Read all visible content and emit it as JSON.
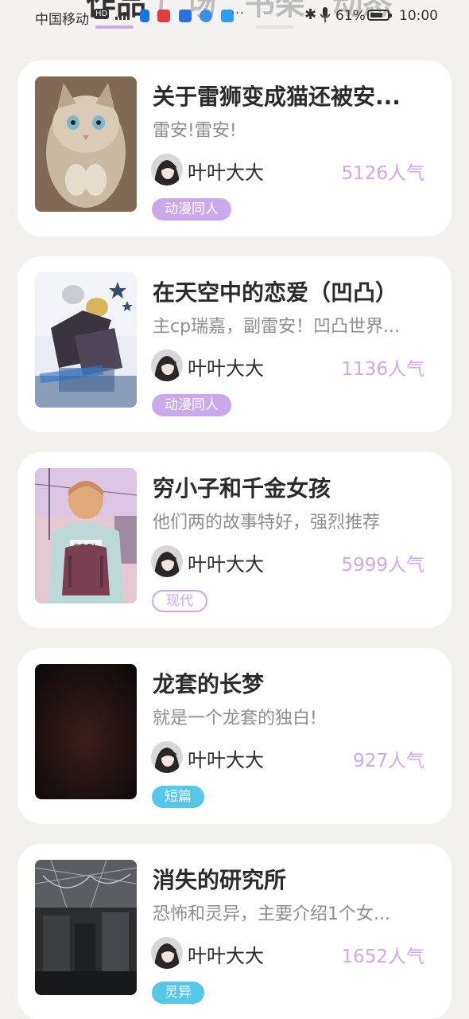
{
  "status_bar": {
    "carrier": "中国移动",
    "hd": "HD",
    "more": "···",
    "battery_pct": "61%",
    "time": "10:00",
    "icons": [
      "signal-icon",
      "wifi-icon",
      "bluetooth-icon",
      "mic-icon",
      "battery-icon"
    ]
  },
  "tabs": [
    {
      "label": "作品",
      "active": true
    },
    {
      "label": "广场",
      "active": false
    },
    {
      "label": "书架",
      "active": false
    },
    {
      "label": "动态",
      "active": false
    }
  ],
  "colors": {
    "accent": "#c9a8ec",
    "popularity": "#cfa9ea",
    "tag_purple": "#c9a8ec",
    "tag_cyan": "#55c8ea",
    "background": "#f3f1ed"
  },
  "works": [
    {
      "title": "关于雷狮变成猫还被安...",
      "desc": "雷安!雷安!",
      "author": "叶叶大大",
      "popularity": "5126人气",
      "tag": "动漫同人",
      "tag_style": "filled",
      "tag_color": "#c9a8ec",
      "cover": "kitten-cover-image"
    },
    {
      "title": "在天空中的恋爱（凹凸）",
      "desc": "主cp瑞嘉，副雷安！凹凸世界...",
      "author": "叶叶大大",
      "popularity": "1136人气",
      "tag": "动漫同人",
      "tag_style": "filled",
      "tag_color": "#c9a8ec",
      "cover": "anime-couple-cover-image"
    },
    {
      "title": "穷小子和千金女孩",
      "desc": "他们两的故事特好，强烈推荐",
      "author": "叶叶大大",
      "popularity": "5999人气",
      "tag": "现代",
      "tag_style": "outline",
      "tag_color": "#c9a8ec",
      "cover": "boy-backpack-cover-image"
    },
    {
      "title": "龙套的长梦",
      "desc": "就是一个龙套的独白!",
      "author": "叶叶大大",
      "popularity": "927人气",
      "tag": "短篇",
      "tag_style": "filled",
      "tag_color": "#55c8ea",
      "cover": "dark-cover-image"
    },
    {
      "title": "消失的研究所",
      "desc": "恐怖和灵异，主要介绍1个女...",
      "author": "叶叶大大",
      "popularity": "1652人气",
      "tag": "灵异",
      "tag_style": "filled",
      "tag_color": "#55c8ea",
      "cover": "haunted-lab-cover-image"
    }
  ]
}
